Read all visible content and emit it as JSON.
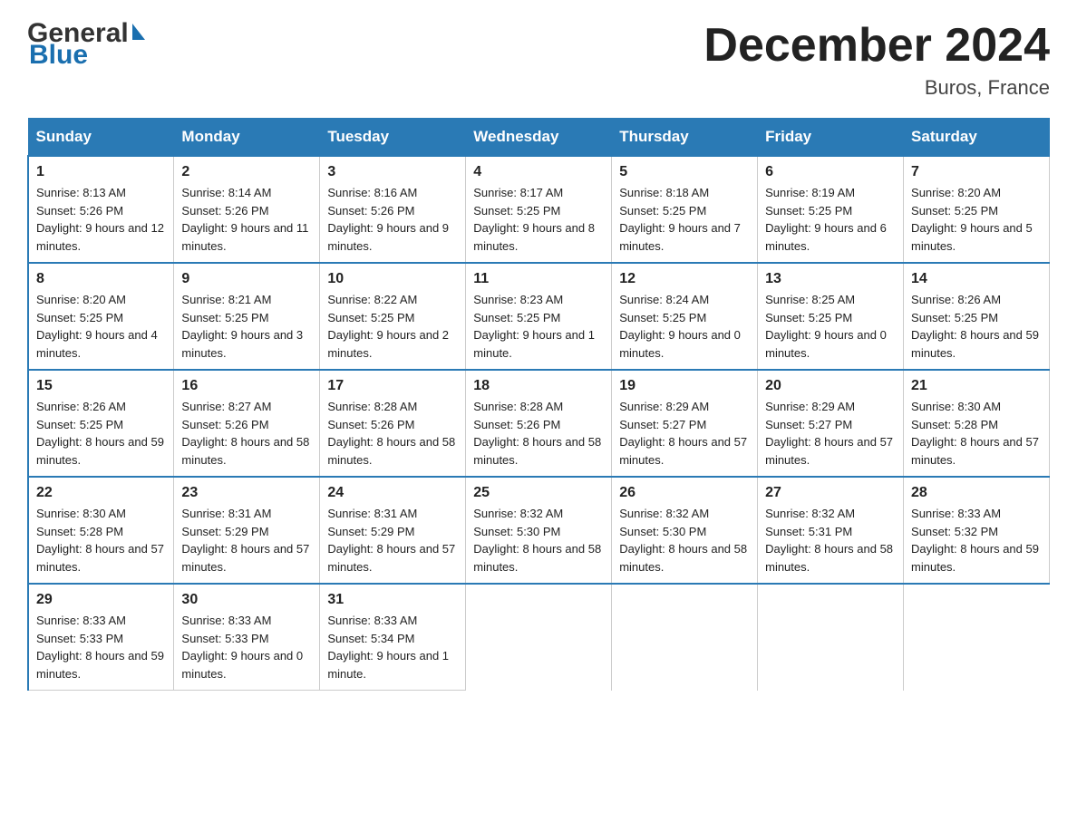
{
  "header": {
    "logo_general": "General",
    "logo_blue": "Blue",
    "month_title": "December 2024",
    "location": "Buros, France"
  },
  "days_of_week": [
    "Sunday",
    "Monday",
    "Tuesday",
    "Wednesday",
    "Thursday",
    "Friday",
    "Saturday"
  ],
  "weeks": [
    [
      {
        "num": "1",
        "sunrise": "8:13 AM",
        "sunset": "5:26 PM",
        "daylight": "9 hours and 12 minutes."
      },
      {
        "num": "2",
        "sunrise": "8:14 AM",
        "sunset": "5:26 PM",
        "daylight": "9 hours and 11 minutes."
      },
      {
        "num": "3",
        "sunrise": "8:16 AM",
        "sunset": "5:26 PM",
        "daylight": "9 hours and 9 minutes."
      },
      {
        "num": "4",
        "sunrise": "8:17 AM",
        "sunset": "5:25 PM",
        "daylight": "9 hours and 8 minutes."
      },
      {
        "num": "5",
        "sunrise": "8:18 AM",
        "sunset": "5:25 PM",
        "daylight": "9 hours and 7 minutes."
      },
      {
        "num": "6",
        "sunrise": "8:19 AM",
        "sunset": "5:25 PM",
        "daylight": "9 hours and 6 minutes."
      },
      {
        "num": "7",
        "sunrise": "8:20 AM",
        "sunset": "5:25 PM",
        "daylight": "9 hours and 5 minutes."
      }
    ],
    [
      {
        "num": "8",
        "sunrise": "8:20 AM",
        "sunset": "5:25 PM",
        "daylight": "9 hours and 4 minutes."
      },
      {
        "num": "9",
        "sunrise": "8:21 AM",
        "sunset": "5:25 PM",
        "daylight": "9 hours and 3 minutes."
      },
      {
        "num": "10",
        "sunrise": "8:22 AM",
        "sunset": "5:25 PM",
        "daylight": "9 hours and 2 minutes."
      },
      {
        "num": "11",
        "sunrise": "8:23 AM",
        "sunset": "5:25 PM",
        "daylight": "9 hours and 1 minute."
      },
      {
        "num": "12",
        "sunrise": "8:24 AM",
        "sunset": "5:25 PM",
        "daylight": "9 hours and 0 minutes."
      },
      {
        "num": "13",
        "sunrise": "8:25 AM",
        "sunset": "5:25 PM",
        "daylight": "9 hours and 0 minutes."
      },
      {
        "num": "14",
        "sunrise": "8:26 AM",
        "sunset": "5:25 PM",
        "daylight": "8 hours and 59 minutes."
      }
    ],
    [
      {
        "num": "15",
        "sunrise": "8:26 AM",
        "sunset": "5:25 PM",
        "daylight": "8 hours and 59 minutes."
      },
      {
        "num": "16",
        "sunrise": "8:27 AM",
        "sunset": "5:26 PM",
        "daylight": "8 hours and 58 minutes."
      },
      {
        "num": "17",
        "sunrise": "8:28 AM",
        "sunset": "5:26 PM",
        "daylight": "8 hours and 58 minutes."
      },
      {
        "num": "18",
        "sunrise": "8:28 AM",
        "sunset": "5:26 PM",
        "daylight": "8 hours and 58 minutes."
      },
      {
        "num": "19",
        "sunrise": "8:29 AM",
        "sunset": "5:27 PM",
        "daylight": "8 hours and 57 minutes."
      },
      {
        "num": "20",
        "sunrise": "8:29 AM",
        "sunset": "5:27 PM",
        "daylight": "8 hours and 57 minutes."
      },
      {
        "num": "21",
        "sunrise": "8:30 AM",
        "sunset": "5:28 PM",
        "daylight": "8 hours and 57 minutes."
      }
    ],
    [
      {
        "num": "22",
        "sunrise": "8:30 AM",
        "sunset": "5:28 PM",
        "daylight": "8 hours and 57 minutes."
      },
      {
        "num": "23",
        "sunrise": "8:31 AM",
        "sunset": "5:29 PM",
        "daylight": "8 hours and 57 minutes."
      },
      {
        "num": "24",
        "sunrise": "8:31 AM",
        "sunset": "5:29 PM",
        "daylight": "8 hours and 57 minutes."
      },
      {
        "num": "25",
        "sunrise": "8:32 AM",
        "sunset": "5:30 PM",
        "daylight": "8 hours and 58 minutes."
      },
      {
        "num": "26",
        "sunrise": "8:32 AM",
        "sunset": "5:30 PM",
        "daylight": "8 hours and 58 minutes."
      },
      {
        "num": "27",
        "sunrise": "8:32 AM",
        "sunset": "5:31 PM",
        "daylight": "8 hours and 58 minutes."
      },
      {
        "num": "28",
        "sunrise": "8:33 AM",
        "sunset": "5:32 PM",
        "daylight": "8 hours and 59 minutes."
      }
    ],
    [
      {
        "num": "29",
        "sunrise": "8:33 AM",
        "sunset": "5:33 PM",
        "daylight": "8 hours and 59 minutes."
      },
      {
        "num": "30",
        "sunrise": "8:33 AM",
        "sunset": "5:33 PM",
        "daylight": "9 hours and 0 minutes."
      },
      {
        "num": "31",
        "sunrise": "8:33 AM",
        "sunset": "5:34 PM",
        "daylight": "9 hours and 1 minute."
      },
      null,
      null,
      null,
      null
    ]
  ]
}
